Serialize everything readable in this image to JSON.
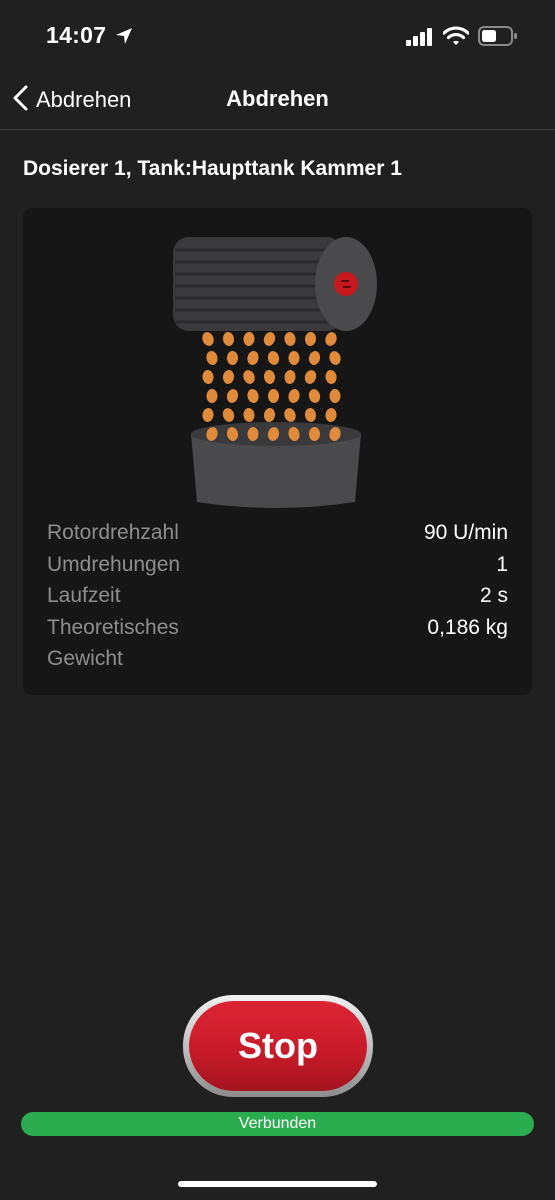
{
  "status_bar": {
    "time": "14:07",
    "icons": [
      "location-arrow-icon",
      "cellular-signal-icon",
      "wifi-icon",
      "battery-icon"
    ]
  },
  "nav": {
    "back_label": "Abdrehen",
    "title": "Abdrehen"
  },
  "section_title": "Dosierer 1, Tank:Haupttank Kammer 1",
  "stats": [
    {
      "label": "Rotordrehzahl",
      "value": "90 U/min"
    },
    {
      "label": "Umdrehungen",
      "value": "1"
    },
    {
      "label": "Laufzeit",
      "value": "2 s"
    },
    {
      "label": "Theoretisches Gewicht",
      "value": "0,186 kg"
    }
  ],
  "stop_button_label": "Stop",
  "connection_status": "Verbunden",
  "colors": {
    "background": "#202020",
    "card": "#161616",
    "stop_red": "#c81b2a",
    "connected_green": "#2bac4f",
    "seed_orange": "#e08a3c"
  }
}
